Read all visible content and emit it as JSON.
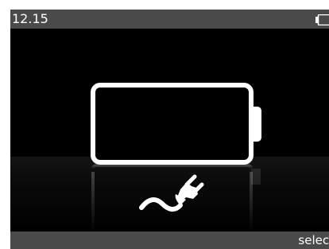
{
  "status_bar": {
    "time": "12.15",
    "battery_icon": "battery-empty-icon"
  },
  "screen": {
    "battery_illustration": "battery-empty-icon",
    "charger_illustration": "power-plug-icon"
  },
  "softkeys": {
    "right_label": "select"
  },
  "colors": {
    "background": "#000000",
    "bars": "#4a4a4a",
    "foreground": "#ffffff"
  }
}
